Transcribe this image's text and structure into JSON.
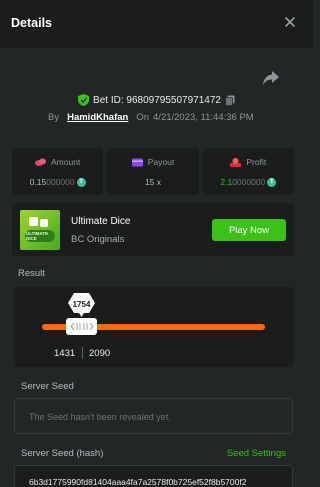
{
  "header": {
    "title": "Details"
  },
  "bet": {
    "id_text": "Bet ID: 96809795507971472",
    "by_label": "By",
    "username": "HamidKhafan",
    "on_label": "On",
    "datetime": "4/21/2023, 11:44:36 PM"
  },
  "stats": {
    "amount": {
      "label": "Amount",
      "value_main": "0.15",
      "value_dim": "000000",
      "currency_icon": "tron-icon"
    },
    "payout": {
      "label": "Payout",
      "value": "15 x"
    },
    "profit": {
      "label": "Profit",
      "value_main": "2.1",
      "value_dim": "0000000",
      "currency_icon": "tron-icon"
    }
  },
  "game": {
    "name": "Ultimate Dice",
    "provider": "BC Originals",
    "play_label": "Play Now",
    "thumb_text": "ULTIMATE DICE"
  },
  "result": {
    "label": "Result",
    "value": "1754",
    "range_low": "1431",
    "range_high": "2090"
  },
  "server_seed": {
    "label": "Server Seed",
    "placeholder": "The Seed hasn't been revealed yet."
  },
  "server_seed_hash": {
    "label": "Server Seed (hash)",
    "settings_link": "Seed Settings",
    "value": "6b3d1775990fd81404aaa4fa7a2578f0b725ef52f8b5700f2"
  },
  "colors": {
    "accent_green": "#3bc117",
    "track_orange": "#ff6a00",
    "tron": "#3bc1a0",
    "amount_icon": "#e0466a",
    "payout_icon": "#8a4ce8",
    "profit_icon": "#e02b3a"
  }
}
